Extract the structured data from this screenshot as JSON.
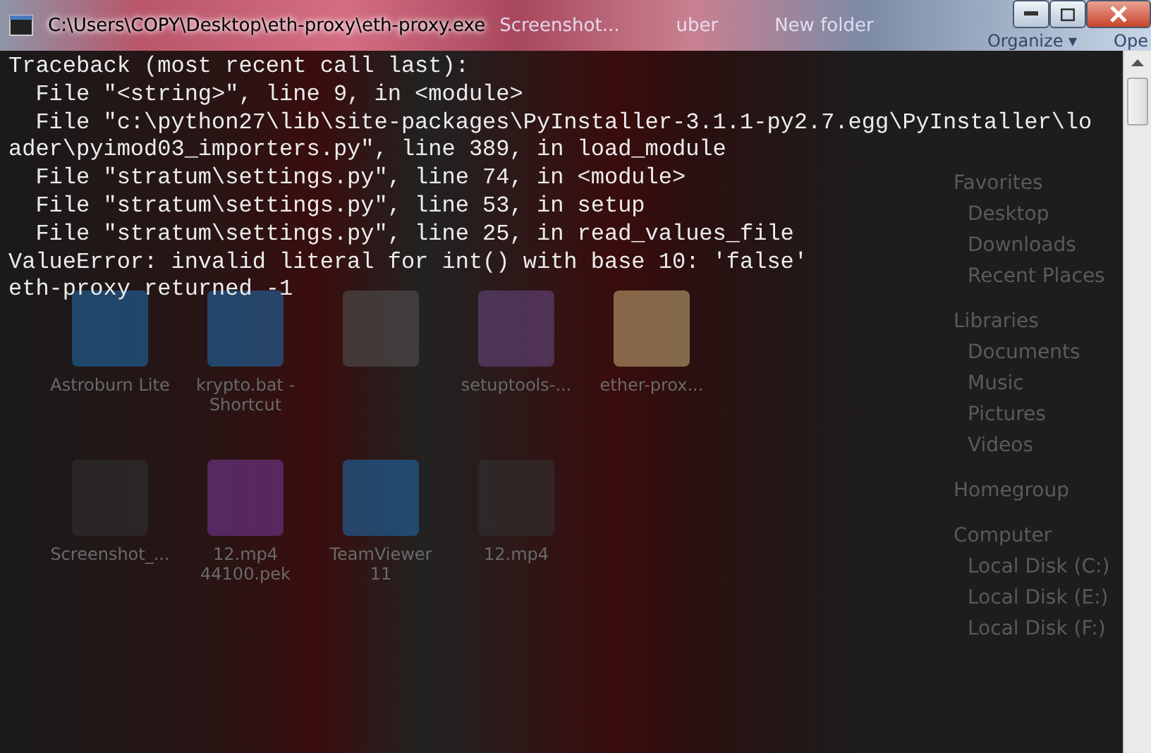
{
  "window": {
    "title": "C:\\Users\\COPY\\Desktop\\eth-proxy\\eth-proxy.exe"
  },
  "behind_titlebar": [
    "Screenshot...",
    "uber",
    "New folder"
  ],
  "explorer": {
    "toolbar": [
      "Organize ▾",
      "Ope"
    ],
    "nav": [
      {
        "label": "Favorites",
        "children": [
          {
            "label": "Desktop"
          },
          {
            "label": "Downloads"
          },
          {
            "label": "Recent Places"
          }
        ]
      },
      {
        "label": "Libraries",
        "children": [
          {
            "label": "Documents"
          },
          {
            "label": "Music"
          },
          {
            "label": "Pictures"
          },
          {
            "label": "Videos"
          }
        ]
      },
      {
        "label": "Homegroup"
      },
      {
        "label": "Computer",
        "children": [
          {
            "label": "Local Disk (C:)"
          },
          {
            "label": "Local Disk (E:)"
          },
          {
            "label": "Local Disk (F:)"
          }
        ]
      }
    ]
  },
  "desktop_icons": [
    {
      "label": "Astroburn Lite",
      "kind": "app"
    },
    {
      "label": "krypto.bat - Shortcut",
      "kind": "app"
    },
    {
      "kind": "blank"
    },
    {
      "label": "setuptools-...",
      "kind": "archive"
    },
    {
      "label": "ether-prox...",
      "kind": "folder"
    },
    {
      "label": "Screenshot_...",
      "kind": "image"
    },
    {
      "label": "12.mp4 44100.pek",
      "kind": "audio"
    },
    {
      "label": "TeamViewer 11",
      "kind": "app"
    },
    {
      "label": "12.mp4",
      "kind": "image"
    }
  ],
  "console": {
    "lines": [
      "Traceback (most recent call last):",
      "  File \"<string>\", line 9, in <module>",
      "  File \"c:\\python27\\lib\\site-packages\\PyInstaller-3.1.1-py2.7.egg\\PyInstaller\\lo",
      "ader\\pyimod03_importers.py\", line 389, in load_module",
      "  File \"stratum\\settings.py\", line 74, in <module>",
      "  File \"stratum\\settings.py\", line 53, in setup",
      "  File \"stratum\\settings.py\", line 25, in read_values_file",
      "ValueError: invalid literal for int() with base 10: 'false'",
      "eth-proxy returned -1"
    ]
  }
}
